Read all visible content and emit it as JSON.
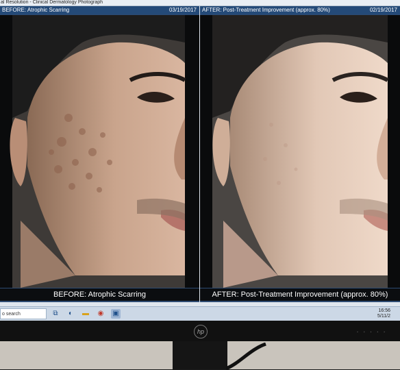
{
  "window": {
    "title": "al Resolution - Clinical Dermatology Photograph"
  },
  "before_pane": {
    "header": "BEFORE: Atrophic Scarring",
    "date": "03/19/2017",
    "caption": "BEFORE: Atrophic Scarring"
  },
  "after_pane": {
    "header": "AFTER: Post-Treatment Improvement (approx. 80%)",
    "date": "02/19/2017",
    "caption": "AFTER: Post-Treatment Improvement (approx. 80%)"
  },
  "taskbar": {
    "search_placeholder": "o search",
    "time": "16:56",
    "date": "5/11/2"
  },
  "icons": {
    "task_view": "task-view-icon",
    "edge": "edge-browser-icon",
    "file_explorer": "folder-icon",
    "chrome": "chrome-icon",
    "photos_app": "photos-app-icon",
    "monitor_logo": "hp-logo"
  },
  "monitor": {
    "logo_text": "hp"
  }
}
